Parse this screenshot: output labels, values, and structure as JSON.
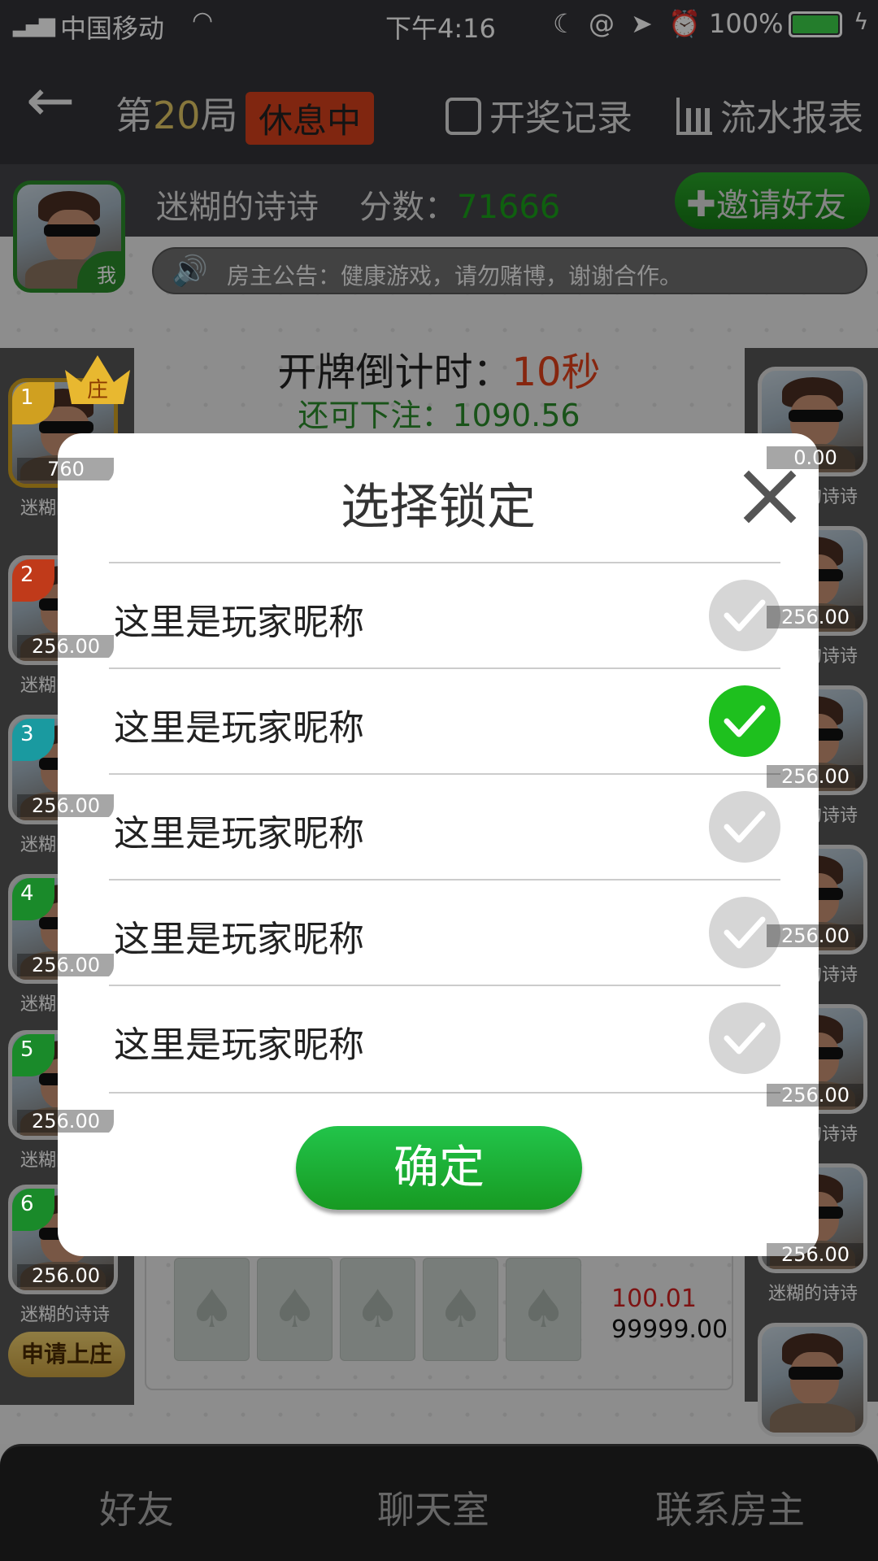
{
  "status_bar": {
    "carrier": "中国移动",
    "time": "下午4:16",
    "battery": "100%"
  },
  "header": {
    "round_prefix": "第",
    "round_number": "20",
    "round_suffix": "局",
    "status_badge": "休息中",
    "history_label": "开奖记录",
    "report_label": "流水报表"
  },
  "user": {
    "name": "迷糊的诗诗",
    "score_label": "分数：",
    "score": "71666",
    "me_tag": "我",
    "invite_label": "邀请好友"
  },
  "announcement": "房主公告：健康游戏，请勿赌博，谢谢合作。",
  "countdown": {
    "label": "开牌倒计时：",
    "value": "10秒",
    "bet_label": "还可下注：",
    "bet_value": "1090.56"
  },
  "left_seats": [
    {
      "rank": "1",
      "amount": "760",
      "name": "迷糊的诗诗",
      "banker_tag": "庄"
    },
    {
      "rank": "2",
      "amount": "256.00",
      "name": "迷糊的诗诗"
    },
    {
      "rank": "3",
      "amount": "256.00",
      "name": "迷糊的诗诗"
    },
    {
      "rank": "4",
      "amount": "256.00",
      "name": "迷糊的诗诗"
    },
    {
      "rank": "5",
      "amount": "256.00",
      "name": "迷糊的诗诗"
    },
    {
      "rank": "6",
      "amount": "256.00",
      "name": "迷糊的诗诗"
    }
  ],
  "apply_banker_label": "申请上庄",
  "right_seats": [
    {
      "amount": "0.00",
      "name": "迷糊的诗诗"
    },
    {
      "amount": "256.00",
      "name": "迷糊的诗诗"
    },
    {
      "amount": "256.00",
      "name": "迷糊的诗诗"
    },
    {
      "amount": "256.00",
      "name": "迷糊的诗诗"
    },
    {
      "amount": "256.00",
      "name": "迷糊的诗诗"
    },
    {
      "amount": "256.00",
      "name": "迷糊的诗诗"
    },
    {
      "amount": "",
      "name": ""
    }
  ],
  "board": {
    "card_suit": "♠",
    "win_amount": "100.01",
    "total_amount": "99999.00"
  },
  "modal": {
    "title": "选择锁定",
    "rows": [
      {
        "label": "这里是玩家昵称",
        "selected": false
      },
      {
        "label": "这里是玩家昵称",
        "selected": true
      },
      {
        "label": "这里是玩家昵称",
        "selected": false
      },
      {
        "label": "这里是玩家昵称",
        "selected": false
      },
      {
        "label": "这里是玩家昵称",
        "selected": false
      }
    ],
    "confirm_label": "确定"
  },
  "bottom_tabs": [
    "好友",
    "聊天室",
    "联系房主"
  ],
  "colors": {
    "accent_green": "#1ec01e",
    "badge_red": "#d6401c",
    "score_green": "#1a9a1a",
    "countdown_red": "#e0401a",
    "gold": "#e8c060"
  }
}
